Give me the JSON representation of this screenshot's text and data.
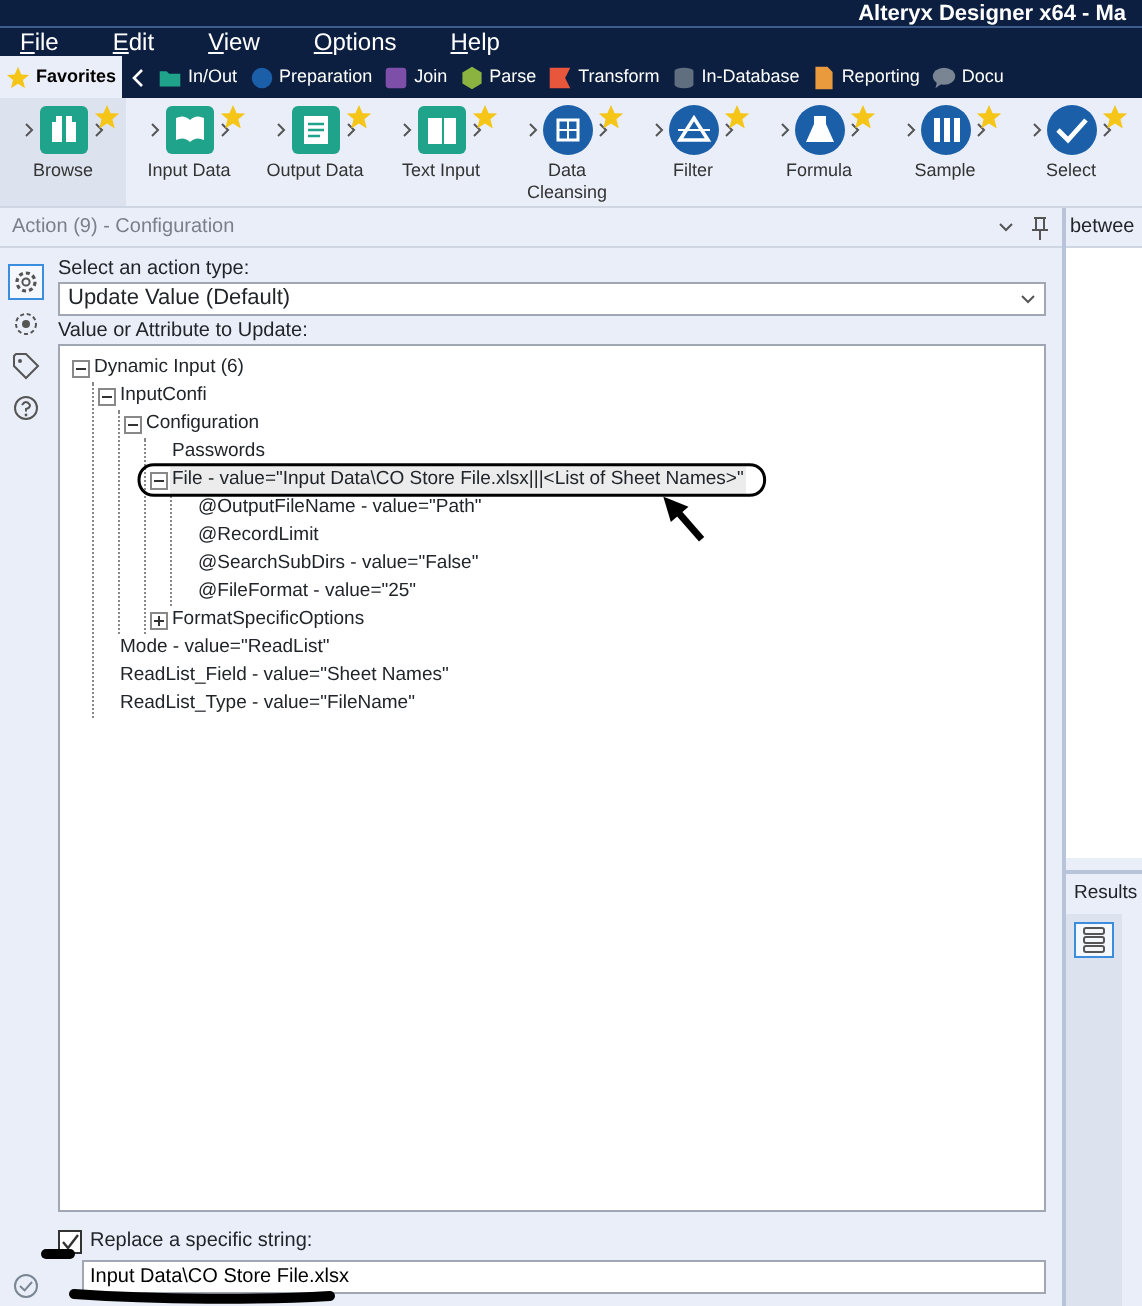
{
  "window": {
    "title": "Alteryx Designer x64 - Ma"
  },
  "menu": [
    "File",
    "Edit",
    "View",
    "Options",
    "Help"
  ],
  "category_tabs": [
    {
      "label": "Favorites",
      "selected": true,
      "kind": "star",
      "color": "#f5c518"
    },
    {
      "label": "In/Out",
      "selected": false,
      "kind": "folder",
      "color": "#1fa38a"
    },
    {
      "label": "Preparation",
      "selected": false,
      "kind": "circle",
      "color": "#1a5fa8"
    },
    {
      "label": "Join",
      "selected": false,
      "kind": "square",
      "color": "#7d4fa8"
    },
    {
      "label": "Parse",
      "selected": false,
      "kind": "hexagon",
      "color": "#8ab33f"
    },
    {
      "label": "Transform",
      "selected": false,
      "kind": "flag",
      "color": "#e8563c"
    },
    {
      "label": "In-Database",
      "selected": false,
      "kind": "database",
      "color": "#5f6f80"
    },
    {
      "label": "Reporting",
      "selected": false,
      "kind": "page",
      "color": "#e89a3c"
    },
    {
      "label": "Docu",
      "selected": false,
      "kind": "bubble",
      "color": "#7a8594"
    }
  ],
  "tools": [
    {
      "label": "Browse",
      "selected": true,
      "kind": "tile",
      "color": "#1fa38a"
    },
    {
      "label": "Input Data",
      "selected": false,
      "kind": "tile",
      "color": "#1fa38a"
    },
    {
      "label": "Output Data",
      "selected": false,
      "kind": "tile",
      "color": "#1fa38a"
    },
    {
      "label": "Text Input",
      "selected": false,
      "kind": "tile",
      "color": "#1fa38a"
    },
    {
      "label": "Data Cleansing",
      "selected": false,
      "kind": "round",
      "color": "#1a5fa8"
    },
    {
      "label": "Filter",
      "selected": false,
      "kind": "round",
      "color": "#1a5fa8"
    },
    {
      "label": "Formula",
      "selected": false,
      "kind": "round",
      "color": "#1a5fa8"
    },
    {
      "label": "Sample",
      "selected": false,
      "kind": "round",
      "color": "#1a5fa8"
    },
    {
      "label": "Select",
      "selected": false,
      "kind": "round",
      "color": "#1a5fa8"
    }
  ],
  "config_panel": {
    "title": "Action (9) - Configuration",
    "side_icons": [
      {
        "kind": "gear",
        "selected": true
      },
      {
        "kind": "target",
        "selected": false
      },
      {
        "kind": "tag",
        "selected": false
      },
      {
        "kind": "help",
        "selected": false
      }
    ],
    "action_type_label": "Select an action type:",
    "action_type": "Update Value (Default)",
    "tree_label": "Value or Attribute to Update:",
    "tree": [
      {
        "label": "Dynamic Input (6)",
        "expanded": true,
        "selected": false,
        "children": [
          {
            "label": "InputConfi",
            "expanded": true,
            "selected": false,
            "children": [
              {
                "label": "Configuration",
                "expanded": true,
                "selected": false,
                "children": [
                  {
                    "label": "Passwords",
                    "selected": false
                  },
                  {
                    "label": "File - value=\"Input Data\\CO Store File.xlsx|||<List of Sheet Names>\"",
                    "expanded": true,
                    "selected": true,
                    "children": [
                      {
                        "label": "@OutputFileName - value=\"Path\"",
                        "selected": false
                      },
                      {
                        "label": "@RecordLimit",
                        "selected": false
                      },
                      {
                        "label": "@SearchSubDirs - value=\"False\"",
                        "selected": false
                      },
                      {
                        "label": "@FileFormat - value=\"25\"",
                        "selected": false
                      }
                    ]
                  },
                  {
                    "label": "FormatSpecificOptions",
                    "expanded": false,
                    "selected": false
                  }
                ]
              }
            ]
          },
          {
            "label": "Mode - value=\"ReadList\"",
            "selected": false
          },
          {
            "label": "ReadList_Field - value=\"Sheet Names\"",
            "selected": false
          },
          {
            "label": "ReadList_Type - value=\"FileName\"",
            "selected": false
          }
        ]
      }
    ],
    "replace_checkbox": {
      "label": "Replace a specific string:",
      "checked": true
    },
    "replace_value": "Input Data\\CO Store File.xlsx"
  },
  "side_panel": {
    "text": "betwee",
    "results_title": "Results"
  }
}
